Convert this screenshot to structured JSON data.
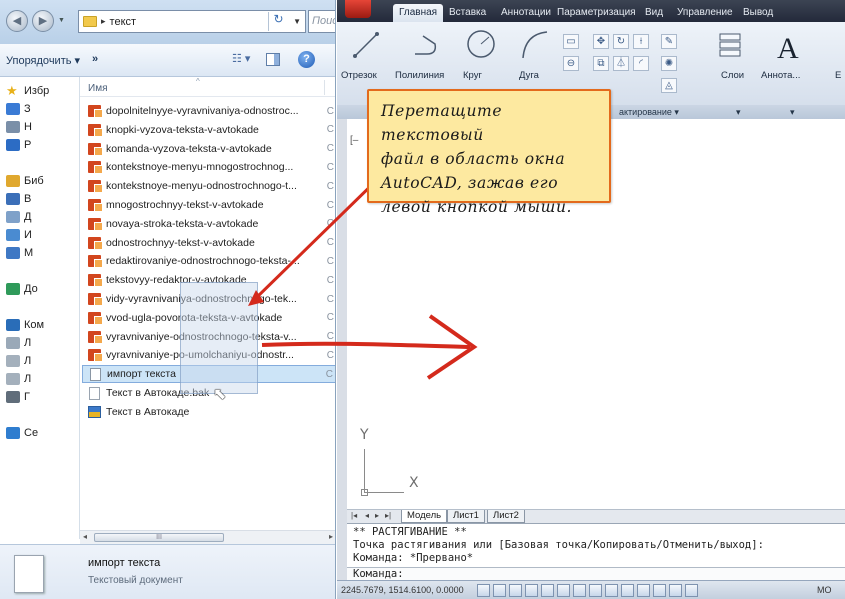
{
  "explorer": {
    "address": {
      "path": "текст",
      "search_placeholder": "Поис"
    },
    "toolbar": {
      "organize": "Упорядочить ▾",
      "more": "»"
    },
    "nav": [
      {
        "label": "Избр",
        "icon": "star-icon"
      },
      {
        "label": "З",
        "icon": "downloads-icon"
      },
      {
        "label": "Н",
        "icon": "recent-places-icon"
      },
      {
        "label": "Р",
        "icon": "desktop-icon"
      },
      {
        "label": "Биб",
        "icon": "libraries-icon"
      },
      {
        "label": "В",
        "icon": "video-library-icon"
      },
      {
        "label": "Д",
        "icon": "documents-library-icon"
      },
      {
        "label": "И",
        "icon": "pictures-library-icon"
      },
      {
        "label": "М",
        "icon": "music-library-icon"
      },
      {
        "label": "До",
        "icon": "homegroup-icon"
      },
      {
        "label": "Ком",
        "icon": "computer-icon"
      },
      {
        "label": "Л",
        "icon": "local-disk-icon"
      },
      {
        "label": "Л",
        "icon": "drive-icon"
      },
      {
        "label": "Л",
        "icon": "drive-icon"
      },
      {
        "label": "Г",
        "icon": "drive-icon"
      },
      {
        "label": "Се",
        "icon": "network-icon"
      }
    ],
    "column_name": "Имя",
    "files": [
      {
        "name": "dopolnitelnyye-vyravnivaniya-odnostroc...",
        "type": "word",
        "trail": "С"
      },
      {
        "name": "knopki-vyzova-teksta-v-avtokade",
        "type": "word",
        "trail": "С"
      },
      {
        "name": "komanda-vyzova-teksta-v-avtokade",
        "type": "word",
        "trail": "С"
      },
      {
        "name": "kontekstnoye-menyu-mnogostrochnog...",
        "type": "word",
        "trail": "С"
      },
      {
        "name": "kontekstnoye-menyu-odnostrochnogo-t...",
        "type": "word",
        "trail": "С"
      },
      {
        "name": "mnogostrochnyy-tekst-v-avtokade",
        "type": "word",
        "trail": "С"
      },
      {
        "name": "novaya-stroka-teksta-v-avtokade",
        "type": "word",
        "trail": "С"
      },
      {
        "name": "odnostrochnyy-tekst-v-avtokade",
        "type": "word",
        "trail": "С"
      },
      {
        "name": "redaktirovaniye-odnostrochnogo-teksta-...",
        "type": "word",
        "trail": "С"
      },
      {
        "name": "tekstovyy-redaktor-v-avtokade",
        "type": "word",
        "trail": "С"
      },
      {
        "name": "vidy-vyravnivaniya-odnostrochnogo-tek...",
        "type": "word",
        "trail": "С"
      },
      {
        "name": "vvod-ugla-povorota-teksta-v-avtokade",
        "type": "word",
        "trail": "С"
      },
      {
        "name": "vyravnivaniye-odnostrochnogo-teksta-v...",
        "type": "word",
        "trail": "С"
      },
      {
        "name": "vyravnivaniye-po-umolchaniyu-odnostr...",
        "type": "word",
        "trail": "С"
      },
      {
        "name": "импорт текста",
        "type": "txt",
        "trail": "С",
        "selected": true
      },
      {
        "name": "Текст в Автокаде.bak",
        "type": "bak",
        "trail": ""
      },
      {
        "name": "Текст в Автокаде",
        "type": "cad",
        "trail": ""
      }
    ],
    "scroll_thumb": "III",
    "details": {
      "name": "импорт текста",
      "type": "Текстовый документ"
    }
  },
  "autocad": {
    "tabs": [
      "Главная",
      "Вставка",
      "Аннотации",
      "Параметризация",
      "Вид",
      "Управление",
      "Вывод"
    ],
    "active_tab": "Главная",
    "tools": {
      "line": "Отрезок",
      "polyline": "Полилиния",
      "circle": "Круг",
      "arc": "Дуга",
      "layers": "Слои",
      "annotation": "Аннота...",
      "extra": "Е"
    },
    "panel_edit": "актирование ▾",
    "panel_dd1": "▾",
    "panel_dd2": "▾",
    "viewport_label": "[–",
    "ucs": {
      "x": "X",
      "y": "Y"
    },
    "layout_tabs": [
      "Модель",
      "Лист1",
      "Лист2"
    ],
    "command": {
      "line1": "** РАСТЯГИВАНИЕ **",
      "line2": "Точка растягивания или [Базовая точка/Копировать/Отменить/выход]:",
      "line3": "Команда: *Прервано*",
      "prompt": "Команда:"
    },
    "status": {
      "coords": "2245.7679, 1514.6100, 0.0000",
      "mode": "MO"
    }
  },
  "callout": {
    "lines": [
      "Перетащите текстовый",
      "файл в область окна",
      "AutoCAD, зажав его",
      "левой кнопкой мыши."
    ]
  },
  "colors": {
    "arrow": "#d42a1c",
    "callout_bg": "#fde9a0",
    "callout_border": "#e36a1c",
    "selection": "#cce4f7"
  }
}
